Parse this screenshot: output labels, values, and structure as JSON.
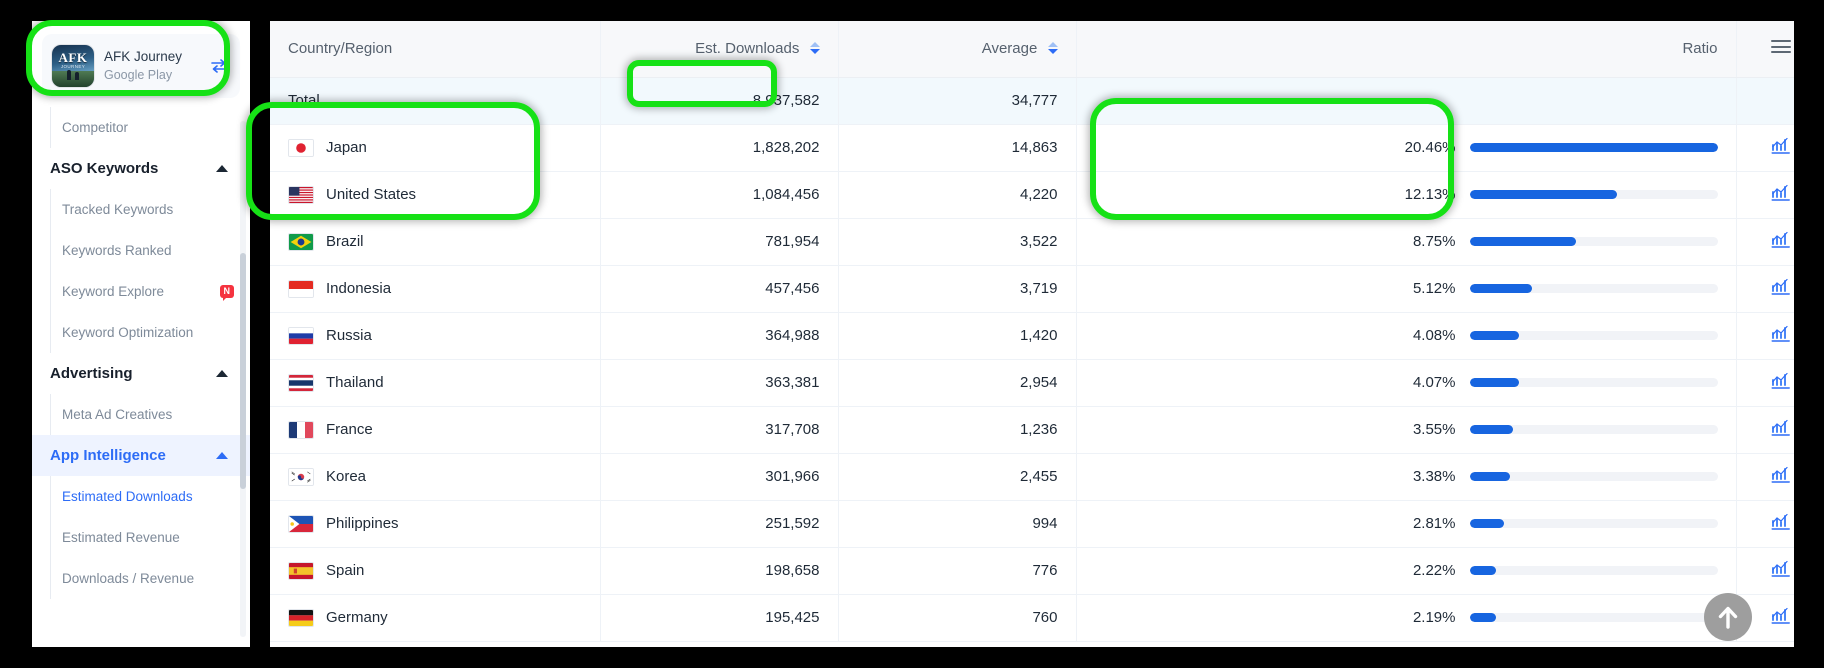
{
  "sidebar": {
    "app": {
      "name": "AFK Journey",
      "store": "Google Play",
      "icon_text": "AFK",
      "icon_sub": "JOURNEY",
      "swap_icon": "swap-arrows-icon"
    },
    "items": [
      {
        "label": "Competitor",
        "type": "sub",
        "active": false,
        "badge": ""
      },
      {
        "label": "ASO Keywords",
        "type": "head",
        "active": false,
        "badge": ""
      },
      {
        "label": "Tracked Keywords",
        "type": "sub",
        "active": false,
        "badge": ""
      },
      {
        "label": "Keywords Ranked",
        "type": "sub",
        "active": false,
        "badge": ""
      },
      {
        "label": "Keyword Explore",
        "type": "sub",
        "active": false,
        "badge": "N"
      },
      {
        "label": "Keyword Optimization",
        "type": "sub",
        "active": false,
        "badge": ""
      },
      {
        "label": "Advertising",
        "type": "head",
        "active": false,
        "badge": ""
      },
      {
        "label": "Meta Ad Creatives",
        "type": "sub",
        "active": false,
        "badge": ""
      },
      {
        "label": "App Intelligence",
        "type": "head",
        "active": true,
        "badge": ""
      },
      {
        "label": "Estimated Downloads",
        "type": "sub",
        "active": true,
        "badge": ""
      },
      {
        "label": "Estimated Revenue",
        "type": "sub",
        "active": false,
        "badge": ""
      },
      {
        "label": "Downloads / Revenue",
        "type": "sub",
        "active": false,
        "badge": ""
      }
    ]
  },
  "table": {
    "columns": [
      {
        "label": "Country/Region",
        "sortable": false
      },
      {
        "label": "Est. Downloads",
        "sortable": true
      },
      {
        "label": "Average",
        "sortable": true
      },
      {
        "label": "Ratio",
        "sortable": false
      },
      {
        "label": "",
        "sortable": false
      }
    ],
    "menu_icon": "hamburger-menu-icon",
    "total_row": {
      "label": "Total",
      "downloads": "8,937,582",
      "average": "34,777",
      "ratio": "",
      "ratio_value": 0
    },
    "rows": [
      {
        "country": "Japan",
        "flag": "flag-jp",
        "downloads": "1,828,202",
        "average": "14,863",
        "ratio": "20.46%",
        "ratio_value": 20.46
      },
      {
        "country": "United States",
        "flag": "flag-us",
        "downloads": "1,084,456",
        "average": "4,220",
        "ratio": "12.13%",
        "ratio_value": 12.13
      },
      {
        "country": "Brazil",
        "flag": "flag-br",
        "downloads": "781,954",
        "average": "3,522",
        "ratio": "8.75%",
        "ratio_value": 8.75
      },
      {
        "country": "Indonesia",
        "flag": "flag-id",
        "downloads": "457,456",
        "average": "3,719",
        "ratio": "5.12%",
        "ratio_value": 5.12
      },
      {
        "country": "Russia",
        "flag": "flag-ru",
        "downloads": "364,988",
        "average": "1,420",
        "ratio": "4.08%",
        "ratio_value": 4.08
      },
      {
        "country": "Thailand",
        "flag": "flag-th",
        "downloads": "363,381",
        "average": "2,954",
        "ratio": "4.07%",
        "ratio_value": 4.07
      },
      {
        "country": "France",
        "flag": "flag-fr",
        "downloads": "317,708",
        "average": "1,236",
        "ratio": "3.55%",
        "ratio_value": 3.55
      },
      {
        "country": "Korea",
        "flag": "flag-kr",
        "downloads": "301,966",
        "average": "2,455",
        "ratio": "3.38%",
        "ratio_value": 3.38
      },
      {
        "country": "Philippines",
        "flag": "flag-ph",
        "downloads": "251,592",
        "average": "994",
        "ratio": "2.81%",
        "ratio_value": 2.81
      },
      {
        "country": "Spain",
        "flag": "flag-es",
        "downloads": "198,658",
        "average": "776",
        "ratio": "2.22%",
        "ratio_value": 2.22
      },
      {
        "country": "Germany",
        "flag": "flag-de",
        "downloads": "195,425",
        "average": "760",
        "ratio": "2.19%",
        "ratio_value": 2.19
      }
    ],
    "row_chart_icon": "bar-chart-icon"
  },
  "scroll_top": {
    "icon": "arrow-up-icon"
  },
  "colors": {
    "accent": "#2d6cf6",
    "bar": "#1765e0",
    "bar_track": "#f1f3f7",
    "total_row_bg": "#f2f9fd",
    "highlight": "#16e116",
    "badge": "#f5333f"
  }
}
